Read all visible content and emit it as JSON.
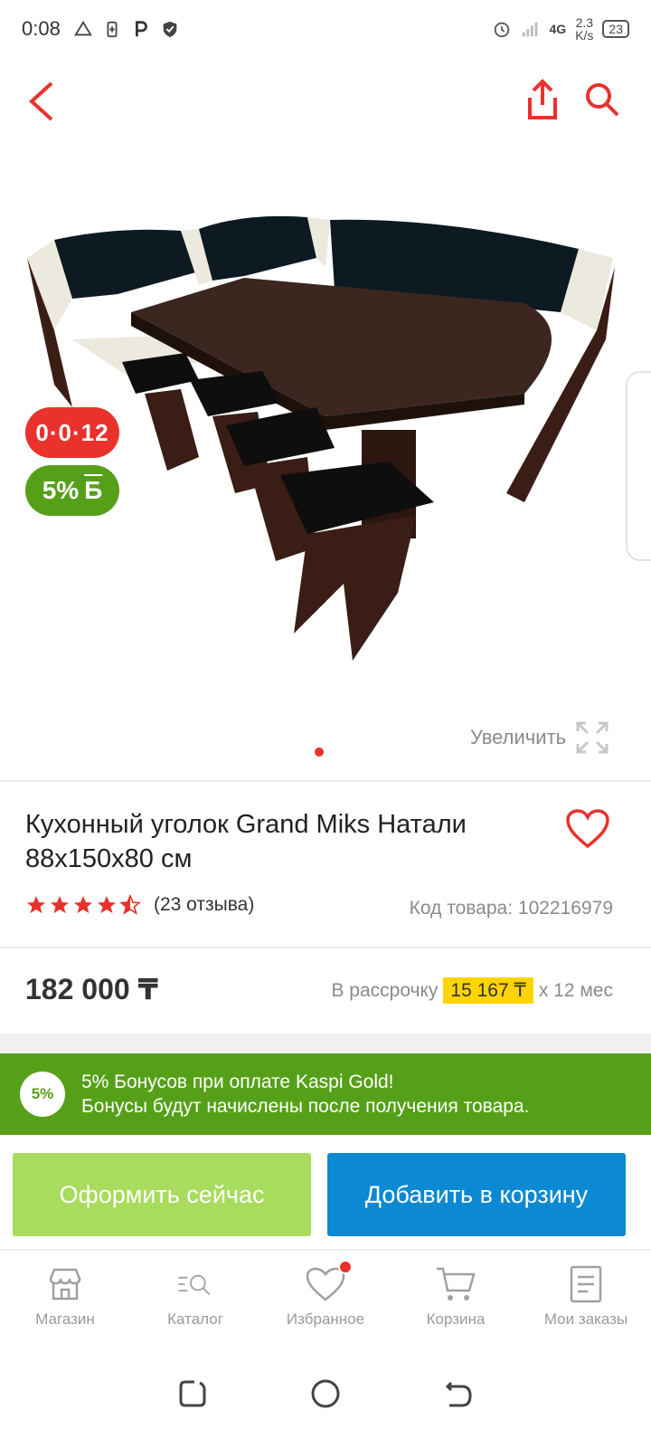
{
  "status_bar": {
    "time": "0:08",
    "network": "4G",
    "speed_value": "2.3",
    "speed_unit": "K/s",
    "battery": "23"
  },
  "product": {
    "installment_badge": "0·0·12",
    "bonus_badge_percent": "5%",
    "bonus_badge_symbol": "Б",
    "zoom_label": "Увеличить",
    "title": "Кухонный уголок Grand Miks Натали 88x150x80 см",
    "rating_value": 4.5,
    "reviews": "(23 отзыва)",
    "sku": "Код товара: 102216979",
    "price": "182 000 ₸",
    "installment_prefix": "В рассрочку",
    "installment_amount": "15 167 ₸",
    "installment_suffix": "x 12 мес"
  },
  "bonus_banner": {
    "circle": "5%",
    "line1": "5% Бонусов при оплате Kaspi Gold!",
    "line2": "Бонусы будут начислены после получения товара."
  },
  "actions": {
    "checkout": "Оформить сейчас",
    "add_to_cart": "Добавить в корзину"
  },
  "tabs": [
    {
      "label": "Магазин",
      "icon": "store-icon"
    },
    {
      "label": "Каталог",
      "icon": "catalog-search-icon"
    },
    {
      "label": "Избранное",
      "icon": "heart-icon"
    },
    {
      "label": "Корзина",
      "icon": "cart-icon"
    },
    {
      "label": "Мои заказы",
      "icon": "orders-icon"
    }
  ],
  "colors": {
    "accent_red": "#e8322b",
    "bonus_green": "#56a019",
    "checkout_green": "#a8dc5c",
    "cart_blue": "#0b89d2",
    "installment_yellow": "#ffd400"
  }
}
